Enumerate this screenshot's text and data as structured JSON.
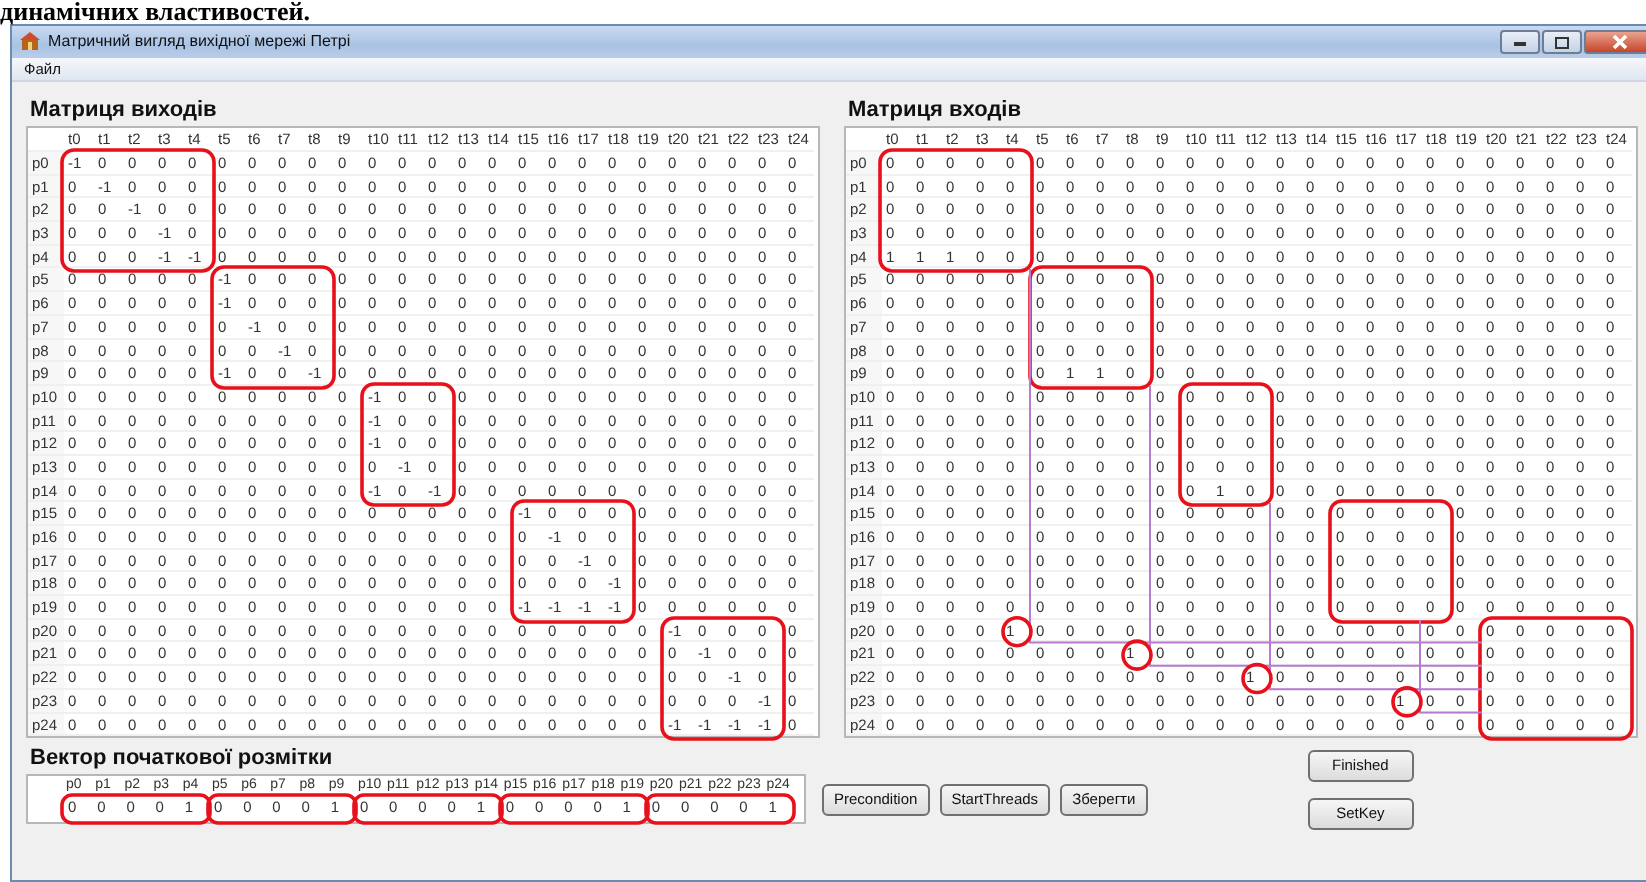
{
  "caption": "динамічних властивостей.",
  "window": {
    "title": "Матричний вигляд вихідної мережі Петрі"
  },
  "menu": [
    "Файл"
  ],
  "output_matrix": {
    "title": "Матриця виходів",
    "columns": [
      "t0",
      "t1",
      "t2",
      "t3",
      "t4",
      "t5",
      "t6",
      "t7",
      "t8",
      "t9",
      "t10",
      "t11",
      "t12",
      "t13",
      "t14",
      "t15",
      "t16",
      "t17",
      "t18",
      "t19",
      "t20",
      "t21",
      "t22",
      "t23",
      "t24"
    ],
    "rows": [
      {
        "label": "p0",
        "values": [
          "-1",
          "0",
          "0",
          "0",
          "0",
          "0",
          "0",
          "0",
          "0",
          "0",
          "0",
          "0",
          "0",
          "0",
          "0",
          "0",
          "0",
          "0",
          "0",
          "0",
          "0",
          "0",
          "0",
          "0",
          "0"
        ]
      },
      {
        "label": "p1",
        "values": [
          "0",
          "-1",
          "0",
          "0",
          "0",
          "0",
          "0",
          "0",
          "0",
          "0",
          "0",
          "0",
          "0",
          "0",
          "0",
          "0",
          "0",
          "0",
          "0",
          "0",
          "0",
          "0",
          "0",
          "0",
          "0"
        ]
      },
      {
        "label": "p2",
        "values": [
          "0",
          "0",
          "-1",
          "0",
          "0",
          "0",
          "0",
          "0",
          "0",
          "0",
          "0",
          "0",
          "0",
          "0",
          "0",
          "0",
          "0",
          "0",
          "0",
          "0",
          "0",
          "0",
          "0",
          "0",
          "0"
        ]
      },
      {
        "label": "p3",
        "values": [
          "0",
          "0",
          "0",
          "-1",
          "0",
          "0",
          "0",
          "0",
          "0",
          "0",
          "0",
          "0",
          "0",
          "0",
          "0",
          "0",
          "0",
          "0",
          "0",
          "0",
          "0",
          "0",
          "0",
          "0",
          "0"
        ]
      },
      {
        "label": "p4",
        "values": [
          "0",
          "0",
          "0",
          "-1",
          "-1",
          "0",
          "0",
          "0",
          "0",
          "0",
          "0",
          "0",
          "0",
          "0",
          "0",
          "0",
          "0",
          "0",
          "0",
          "0",
          "0",
          "0",
          "0",
          "0",
          "0"
        ]
      },
      {
        "label": "p5",
        "values": [
          "0",
          "0",
          "0",
          "0",
          "0",
          "-1",
          "0",
          "0",
          "0",
          "0",
          "0",
          "0",
          "0",
          "0",
          "0",
          "0",
          "0",
          "0",
          "0",
          "0",
          "0",
          "0",
          "0",
          "0",
          "0"
        ]
      },
      {
        "label": "p6",
        "values": [
          "0",
          "0",
          "0",
          "0",
          "0",
          "-1",
          "0",
          "0",
          "0",
          "0",
          "0",
          "0",
          "0",
          "0",
          "0",
          "0",
          "0",
          "0",
          "0",
          "0",
          "0",
          "0",
          "0",
          "0",
          "0"
        ]
      },
      {
        "label": "p7",
        "values": [
          "0",
          "0",
          "0",
          "0",
          "0",
          "0",
          "-1",
          "0",
          "0",
          "0",
          "0",
          "0",
          "0",
          "0",
          "0",
          "0",
          "0",
          "0",
          "0",
          "0",
          "0",
          "0",
          "0",
          "0",
          "0"
        ]
      },
      {
        "label": "p8",
        "values": [
          "0",
          "0",
          "0",
          "0",
          "0",
          "0",
          "0",
          "-1",
          "0",
          "0",
          "0",
          "0",
          "0",
          "0",
          "0",
          "0",
          "0",
          "0",
          "0",
          "0",
          "0",
          "0",
          "0",
          "0",
          "0"
        ]
      },
      {
        "label": "p9",
        "values": [
          "0",
          "0",
          "0",
          "0",
          "0",
          "-1",
          "0",
          "0",
          "-1",
          "0",
          "0",
          "0",
          "0",
          "0",
          "0",
          "0",
          "0",
          "0",
          "0",
          "0",
          "0",
          "0",
          "0",
          "0",
          "0"
        ]
      },
      {
        "label": "p10",
        "values": [
          "0",
          "0",
          "0",
          "0",
          "0",
          "0",
          "0",
          "0",
          "0",
          "0",
          "-1",
          "0",
          "0",
          "0",
          "0",
          "0",
          "0",
          "0",
          "0",
          "0",
          "0",
          "0",
          "0",
          "0",
          "0"
        ]
      },
      {
        "label": "p11",
        "values": [
          "0",
          "0",
          "0",
          "0",
          "0",
          "0",
          "0",
          "0",
          "0",
          "0",
          "-1",
          "0",
          "0",
          "0",
          "0",
          "0",
          "0",
          "0",
          "0",
          "0",
          "0",
          "0",
          "0",
          "0",
          "0"
        ]
      },
      {
        "label": "p12",
        "values": [
          "0",
          "0",
          "0",
          "0",
          "0",
          "0",
          "0",
          "0",
          "0",
          "0",
          "-1",
          "0",
          "0",
          "0",
          "0",
          "0",
          "0",
          "0",
          "0",
          "0",
          "0",
          "0",
          "0",
          "0",
          "0"
        ]
      },
      {
        "label": "p13",
        "values": [
          "0",
          "0",
          "0",
          "0",
          "0",
          "0",
          "0",
          "0",
          "0",
          "0",
          "0",
          "-1",
          "0",
          "0",
          "0",
          "0",
          "0",
          "0",
          "0",
          "0",
          "0",
          "0",
          "0",
          "0",
          "0"
        ]
      },
      {
        "label": "p14",
        "values": [
          "0",
          "0",
          "0",
          "0",
          "0",
          "0",
          "0",
          "0",
          "0",
          "0",
          "-1",
          "0",
          "-1",
          "0",
          "0",
          "0",
          "0",
          "0",
          "0",
          "0",
          "0",
          "0",
          "0",
          "0",
          "0"
        ]
      },
      {
        "label": "p15",
        "values": [
          "0",
          "0",
          "0",
          "0",
          "0",
          "0",
          "0",
          "0",
          "0",
          "0",
          "0",
          "0",
          "0",
          "0",
          "0",
          "-1",
          "0",
          "0",
          "0",
          "0",
          "0",
          "0",
          "0",
          "0",
          "0"
        ]
      },
      {
        "label": "p16",
        "values": [
          "0",
          "0",
          "0",
          "0",
          "0",
          "0",
          "0",
          "0",
          "0",
          "0",
          "0",
          "0",
          "0",
          "0",
          "0",
          "0",
          "-1",
          "0",
          "0",
          "0",
          "0",
          "0",
          "0",
          "0",
          "0"
        ]
      },
      {
        "label": "p17",
        "values": [
          "0",
          "0",
          "0",
          "0",
          "0",
          "0",
          "0",
          "0",
          "0",
          "0",
          "0",
          "0",
          "0",
          "0",
          "0",
          "0",
          "0",
          "-1",
          "0",
          "0",
          "0",
          "0",
          "0",
          "0",
          "0"
        ]
      },
      {
        "label": "p18",
        "values": [
          "0",
          "0",
          "0",
          "0",
          "0",
          "0",
          "0",
          "0",
          "0",
          "0",
          "0",
          "0",
          "0",
          "0",
          "0",
          "0",
          "0",
          "0",
          "-1",
          "0",
          "0",
          "0",
          "0",
          "0",
          "0"
        ]
      },
      {
        "label": "p19",
        "values": [
          "0",
          "0",
          "0",
          "0",
          "0",
          "0",
          "0",
          "0",
          "0",
          "0",
          "0",
          "0",
          "0",
          "0",
          "0",
          "-1",
          "-1",
          "-1",
          "-1",
          "0",
          "0",
          "0",
          "0",
          "0",
          "0"
        ]
      },
      {
        "label": "p20",
        "values": [
          "0",
          "0",
          "0",
          "0",
          "0",
          "0",
          "0",
          "0",
          "0",
          "0",
          "0",
          "0",
          "0",
          "0",
          "0",
          "0",
          "0",
          "0",
          "0",
          "0",
          "-1",
          "0",
          "0",
          "0",
          "0"
        ]
      },
      {
        "label": "p21",
        "values": [
          "0",
          "0",
          "0",
          "0",
          "0",
          "0",
          "0",
          "0",
          "0",
          "0",
          "0",
          "0",
          "0",
          "0",
          "0",
          "0",
          "0",
          "0",
          "0",
          "0",
          "0",
          "-1",
          "0",
          "0",
          "0"
        ]
      },
      {
        "label": "p22",
        "values": [
          "0",
          "0",
          "0",
          "0",
          "0",
          "0",
          "0",
          "0",
          "0",
          "0",
          "0",
          "0",
          "0",
          "0",
          "0",
          "0",
          "0",
          "0",
          "0",
          "0",
          "0",
          "0",
          "-1",
          "0",
          "0"
        ]
      },
      {
        "label": "p23",
        "values": [
          "0",
          "0",
          "0",
          "0",
          "0",
          "0",
          "0",
          "0",
          "0",
          "0",
          "0",
          "0",
          "0",
          "0",
          "0",
          "0",
          "0",
          "0",
          "0",
          "0",
          "0",
          "0",
          "0",
          "-1",
          "0"
        ]
      },
      {
        "label": "p24",
        "values": [
          "0",
          "0",
          "0",
          "0",
          "0",
          "0",
          "0",
          "0",
          "0",
          "0",
          "0",
          "0",
          "0",
          "0",
          "0",
          "0",
          "0",
          "0",
          "0",
          "0",
          "-1",
          "-1",
          "-1",
          "-1",
          "0"
        ]
      }
    ]
  },
  "input_matrix": {
    "title": "Матриця входів",
    "columns": [
      "t0",
      "t1",
      "t2",
      "t3",
      "t4",
      "t5",
      "t6",
      "t7",
      "t8",
      "t9",
      "t10",
      "t11",
      "t12",
      "t13",
      "t14",
      "t15",
      "t16",
      "t17",
      "t18",
      "t19",
      "t20",
      "t21",
      "t22",
      "t23",
      "t24"
    ],
    "rows": [
      {
        "label": "p0",
        "values": [
          "0",
          "0",
          "0",
          "0",
          "0",
          "0",
          "0",
          "0",
          "0",
          "0",
          "0",
          "0",
          "0",
          "0",
          "0",
          "0",
          "0",
          "0",
          "0",
          "0",
          "0",
          "0",
          "0",
          "0",
          "0"
        ]
      },
      {
        "label": "p1",
        "values": [
          "0",
          "0",
          "0",
          "0",
          "0",
          "0",
          "0",
          "0",
          "0",
          "0",
          "0",
          "0",
          "0",
          "0",
          "0",
          "0",
          "0",
          "0",
          "0",
          "0",
          "0",
          "0",
          "0",
          "0",
          "0"
        ]
      },
      {
        "label": "p2",
        "values": [
          "0",
          "0",
          "0",
          "0",
          "0",
          "0",
          "0",
          "0",
          "0",
          "0",
          "0",
          "0",
          "0",
          "0",
          "0",
          "0",
          "0",
          "0",
          "0",
          "0",
          "0",
          "0",
          "0",
          "0",
          "0"
        ]
      },
      {
        "label": "p3",
        "values": [
          "0",
          "0",
          "0",
          "0",
          "0",
          "0",
          "0",
          "0",
          "0",
          "0",
          "0",
          "0",
          "0",
          "0",
          "0",
          "0",
          "0",
          "0",
          "0",
          "0",
          "0",
          "0",
          "0",
          "0",
          "0"
        ]
      },
      {
        "label": "p4",
        "values": [
          "1",
          "1",
          "1",
          "0",
          "0",
          "0",
          "0",
          "0",
          "0",
          "0",
          "0",
          "0",
          "0",
          "0",
          "0",
          "0",
          "0",
          "0",
          "0",
          "0",
          "0",
          "0",
          "0",
          "0",
          "0"
        ]
      },
      {
        "label": "p5",
        "values": [
          "0",
          "0",
          "0",
          "0",
          "0",
          "0",
          "0",
          "0",
          "0",
          "0",
          "0",
          "0",
          "0",
          "0",
          "0",
          "0",
          "0",
          "0",
          "0",
          "0",
          "0",
          "0",
          "0",
          "0",
          "0"
        ]
      },
      {
        "label": "p6",
        "values": [
          "0",
          "0",
          "0",
          "0",
          "0",
          "0",
          "0",
          "0",
          "0",
          "0",
          "0",
          "0",
          "0",
          "0",
          "0",
          "0",
          "0",
          "0",
          "0",
          "0",
          "0",
          "0",
          "0",
          "0",
          "0"
        ]
      },
      {
        "label": "p7",
        "values": [
          "0",
          "0",
          "0",
          "0",
          "0",
          "0",
          "0",
          "0",
          "0",
          "0",
          "0",
          "0",
          "0",
          "0",
          "0",
          "0",
          "0",
          "0",
          "0",
          "0",
          "0",
          "0",
          "0",
          "0",
          "0"
        ]
      },
      {
        "label": "p8",
        "values": [
          "0",
          "0",
          "0",
          "0",
          "0",
          "0",
          "0",
          "0",
          "0",
          "0",
          "0",
          "0",
          "0",
          "0",
          "0",
          "0",
          "0",
          "0",
          "0",
          "0",
          "0",
          "0",
          "0",
          "0",
          "0"
        ]
      },
      {
        "label": "p9",
        "values": [
          "0",
          "0",
          "0",
          "0",
          "0",
          "0",
          "1",
          "1",
          "0",
          "0",
          "0",
          "0",
          "0",
          "0",
          "0",
          "0",
          "0",
          "0",
          "0",
          "0",
          "0",
          "0",
          "0",
          "0",
          "0"
        ]
      },
      {
        "label": "p10",
        "values": [
          "0",
          "0",
          "0",
          "0",
          "0",
          "0",
          "0",
          "0",
          "0",
          "0",
          "0",
          "0",
          "0",
          "0",
          "0",
          "0",
          "0",
          "0",
          "0",
          "0",
          "0",
          "0",
          "0",
          "0",
          "0"
        ]
      },
      {
        "label": "p11",
        "values": [
          "0",
          "0",
          "0",
          "0",
          "0",
          "0",
          "0",
          "0",
          "0",
          "0",
          "0",
          "0",
          "0",
          "0",
          "0",
          "0",
          "0",
          "0",
          "0",
          "0",
          "0",
          "0",
          "0",
          "0",
          "0"
        ]
      },
      {
        "label": "p12",
        "values": [
          "0",
          "0",
          "0",
          "0",
          "0",
          "0",
          "0",
          "0",
          "0",
          "0",
          "0",
          "0",
          "0",
          "0",
          "0",
          "0",
          "0",
          "0",
          "0",
          "0",
          "0",
          "0",
          "0",
          "0",
          "0"
        ]
      },
      {
        "label": "p13",
        "values": [
          "0",
          "0",
          "0",
          "0",
          "0",
          "0",
          "0",
          "0",
          "0",
          "0",
          "0",
          "0",
          "0",
          "0",
          "0",
          "0",
          "0",
          "0",
          "0",
          "0",
          "0",
          "0",
          "0",
          "0",
          "0"
        ]
      },
      {
        "label": "p14",
        "values": [
          "0",
          "0",
          "0",
          "0",
          "0",
          "0",
          "0",
          "0",
          "0",
          "0",
          "0",
          "1",
          "0",
          "0",
          "0",
          "0",
          "0",
          "0",
          "0",
          "0",
          "0",
          "0",
          "0",
          "0",
          "0"
        ]
      },
      {
        "label": "p15",
        "values": [
          "0",
          "0",
          "0",
          "0",
          "0",
          "0",
          "0",
          "0",
          "0",
          "0",
          "0",
          "0",
          "0",
          "0",
          "0",
          "0",
          "0",
          "0",
          "0",
          "0",
          "0",
          "0",
          "0",
          "0",
          "0"
        ]
      },
      {
        "label": "p16",
        "values": [
          "0",
          "0",
          "0",
          "0",
          "0",
          "0",
          "0",
          "0",
          "0",
          "0",
          "0",
          "0",
          "0",
          "0",
          "0",
          "0",
          "0",
          "0",
          "0",
          "0",
          "0",
          "0",
          "0",
          "0",
          "0"
        ]
      },
      {
        "label": "p17",
        "values": [
          "0",
          "0",
          "0",
          "0",
          "0",
          "0",
          "0",
          "0",
          "0",
          "0",
          "0",
          "0",
          "0",
          "0",
          "0",
          "0",
          "0",
          "0",
          "0",
          "0",
          "0",
          "0",
          "0",
          "0",
          "0"
        ]
      },
      {
        "label": "p18",
        "values": [
          "0",
          "0",
          "0",
          "0",
          "0",
          "0",
          "0",
          "0",
          "0",
          "0",
          "0",
          "0",
          "0",
          "0",
          "0",
          "0",
          "0",
          "0",
          "0",
          "0",
          "0",
          "0",
          "0",
          "0",
          "0"
        ]
      },
      {
        "label": "p19",
        "values": [
          "0",
          "0",
          "0",
          "0",
          "0",
          "0",
          "0",
          "0",
          "0",
          "0",
          "0",
          "0",
          "0",
          "0",
          "0",
          "0",
          "0",
          "0",
          "0",
          "0",
          "0",
          "0",
          "0",
          "0",
          "0"
        ]
      },
      {
        "label": "p20",
        "values": [
          "0",
          "0",
          "0",
          "0",
          "1",
          "0",
          "0",
          "0",
          "0",
          "0",
          "0",
          "0",
          "0",
          "0",
          "0",
          "0",
          "0",
          "0",
          "0",
          "0",
          "0",
          "0",
          "0",
          "0",
          "0"
        ]
      },
      {
        "label": "p21",
        "values": [
          "0",
          "0",
          "0",
          "0",
          "0",
          "0",
          "0",
          "0",
          "1",
          "0",
          "0",
          "0",
          "0",
          "0",
          "0",
          "0",
          "0",
          "0",
          "0",
          "0",
          "0",
          "0",
          "0",
          "0",
          "0"
        ]
      },
      {
        "label": "p22",
        "values": [
          "0",
          "0",
          "0",
          "0",
          "0",
          "0",
          "0",
          "0",
          "0",
          "0",
          "0",
          "0",
          "1",
          "0",
          "0",
          "0",
          "0",
          "0",
          "0",
          "0",
          "0",
          "0",
          "0",
          "0",
          "0"
        ]
      },
      {
        "label": "p23",
        "values": [
          "0",
          "0",
          "0",
          "0",
          "0",
          "0",
          "0",
          "0",
          "0",
          "0",
          "0",
          "0",
          "0",
          "0",
          "0",
          "0",
          "0",
          "1",
          "0",
          "0",
          "0",
          "0",
          "0",
          "0",
          "0"
        ]
      },
      {
        "label": "p24",
        "values": [
          "0",
          "0",
          "0",
          "0",
          "0",
          "0",
          "0",
          "0",
          "0",
          "0",
          "0",
          "0",
          "0",
          "0",
          "0",
          "0",
          "0",
          "0",
          "0",
          "0",
          "0",
          "0",
          "0",
          "0",
          "0"
        ]
      }
    ]
  },
  "marking_vector": {
    "title": "Вектор початкової розмітки",
    "columns": [
      "p0",
      "p1",
      "p2",
      "p3",
      "p4",
      "p5",
      "p6",
      "p7",
      "p8",
      "p9",
      "p10",
      "p11",
      "p12",
      "p13",
      "p14",
      "p15",
      "p16",
      "p17",
      "p18",
      "p19",
      "p20",
      "p21",
      "p22",
      "p23",
      "p24"
    ],
    "values": [
      "0",
      "0",
      "0",
      "0",
      "1",
      "0",
      "0",
      "0",
      "0",
      "1",
      "0",
      "0",
      "0",
      "0",
      "1",
      "0",
      "0",
      "0",
      "0",
      "1",
      "0",
      "0",
      "0",
      "0",
      "1"
    ]
  },
  "action_buttons": [
    "Precondition",
    "StartThreads",
    "Зберегти"
  ],
  "side_buttons": [
    "Finished",
    "SetKey"
  ]
}
